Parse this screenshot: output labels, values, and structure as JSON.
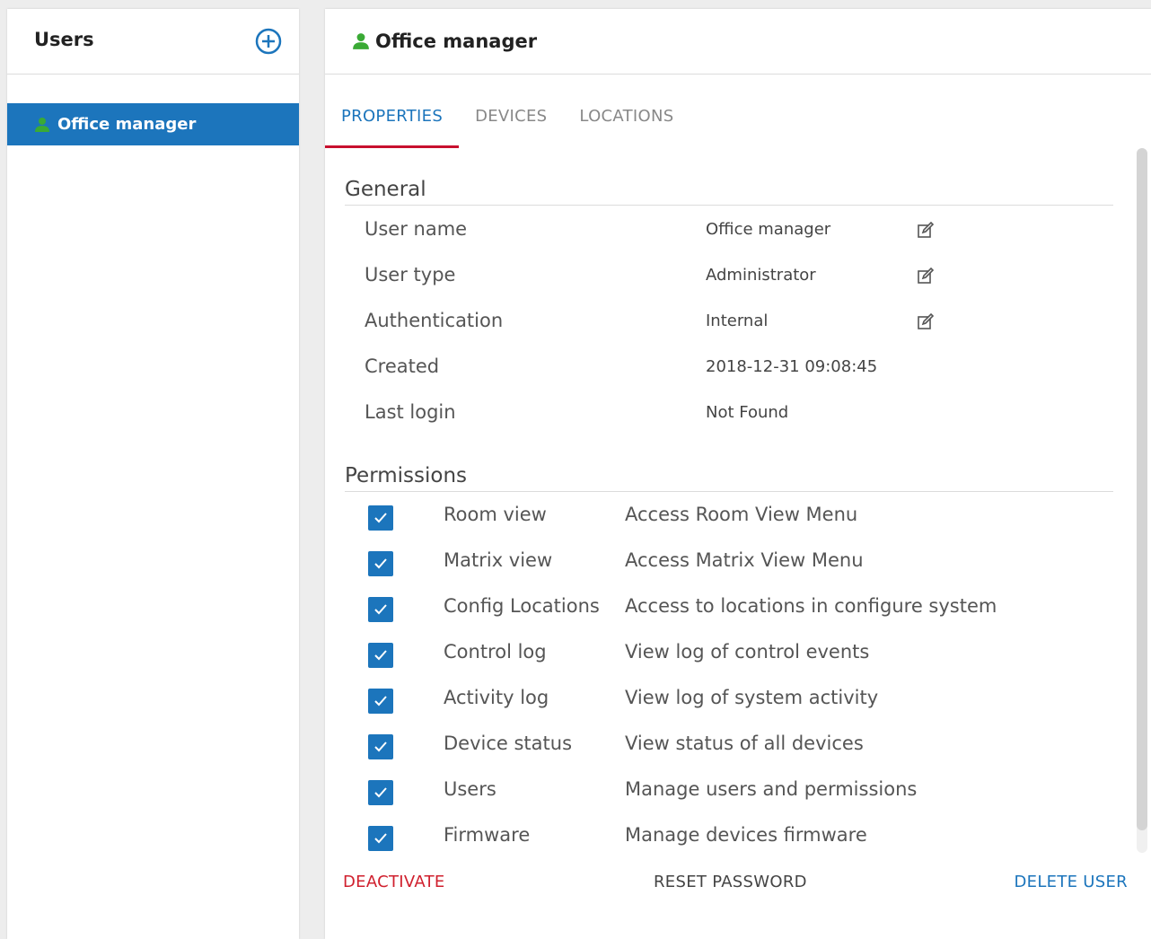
{
  "users_panel": {
    "title": "Users",
    "add_icon": "plus-circle-icon",
    "items": [
      {
        "label": "Office manager",
        "icon": "user-icon",
        "selected": true
      }
    ]
  },
  "detail": {
    "title": "Office manager",
    "title_icon": "user-icon",
    "tabs": [
      {
        "label": "PROPERTIES",
        "active": true
      },
      {
        "label": "DEVICES",
        "active": false
      },
      {
        "label": "LOCATIONS",
        "active": false
      }
    ],
    "general": {
      "heading": "General",
      "rows": [
        {
          "label": "User name",
          "value": "Office manager",
          "editable": true
        },
        {
          "label": "User type",
          "value": "Administrator",
          "editable": true
        },
        {
          "label": "Authentication",
          "value": "Internal",
          "editable": true
        },
        {
          "label": "Created",
          "value": "2018-12-31 09:08:45",
          "editable": false
        },
        {
          "label": "Last login",
          "value": "Not Found",
          "editable": false
        }
      ]
    },
    "permissions": {
      "heading": "Permissions",
      "rows": [
        {
          "name": "Room view",
          "description": "Access Room View Menu",
          "checked": true
        },
        {
          "name": "Matrix view",
          "description": "Access Matrix View Menu",
          "checked": true
        },
        {
          "name": "Config Locations",
          "description": "Access to locations in configure system",
          "checked": true
        },
        {
          "name": "Control log",
          "description": "View log of control events",
          "checked": true
        },
        {
          "name": "Activity log",
          "description": "View log of system activity",
          "checked": true
        },
        {
          "name": "Device status",
          "description": "View status of all devices",
          "checked": true
        },
        {
          "name": "Users",
          "description": "Manage users and permissions",
          "checked": true
        },
        {
          "name": "Firmware",
          "description": "Manage devices firmware",
          "checked": true
        }
      ]
    },
    "actions": {
      "deactivate": "DEACTIVATE",
      "reset_password": "RESET PASSWORD",
      "delete_user": "DELETE USER"
    }
  },
  "colors": {
    "accent": "#1c75bc",
    "danger": "#d0202e",
    "tab_underline": "#c8102e",
    "user_icon": "#3aaa35"
  }
}
